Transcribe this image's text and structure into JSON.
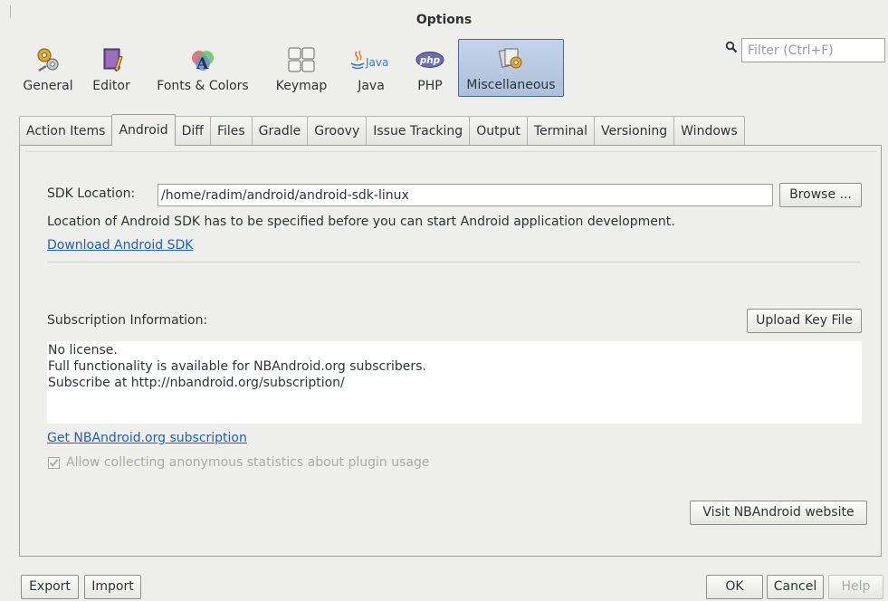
{
  "window": {
    "title": "Options"
  },
  "categories": [
    {
      "label": "General",
      "icon": "gears-icon"
    },
    {
      "label": "Editor",
      "icon": "editor-icon"
    },
    {
      "label": "Fonts & Colors",
      "icon": "fonts-colors-icon"
    },
    {
      "label": "Keymap",
      "icon": "keymap-icon"
    },
    {
      "label": "Java",
      "icon": "java-icon",
      "icon_text": "Java"
    },
    {
      "label": "PHP",
      "icon": "php-icon",
      "icon_text": "php"
    },
    {
      "label": "Miscellaneous",
      "icon": "miscellaneous-icon",
      "selected": true
    }
  ],
  "filter": {
    "placeholder": "Filter (Ctrl+F)"
  },
  "tabs": [
    {
      "label": "Action Items"
    },
    {
      "label": "Android",
      "active": true
    },
    {
      "label": "Diff"
    },
    {
      "label": "Files"
    },
    {
      "label": "Gradle"
    },
    {
      "label": "Groovy"
    },
    {
      "label": "Issue Tracking"
    },
    {
      "label": "Output"
    },
    {
      "label": "Terminal"
    },
    {
      "label": "Versioning"
    },
    {
      "label": "Windows"
    }
  ],
  "android": {
    "sdk_label": "SDK Location:",
    "sdk_value": "/home/radim/android/android-sdk-linux",
    "browse_label": "Browse ...",
    "sdk_hint": "Location of Android SDK has to be specified before you can start Android application development.",
    "download_link": "Download Android SDK",
    "subscription_label": "Subscription Information:",
    "upload_label": "Upload Key File",
    "license_lines": [
      "No license.",
      "Full functionality is available for NBAndroid.org subscribers.",
      "Subscribe at http://nbandroid.org/subscription/"
    ],
    "get_subscription_link": "Get NBAndroid.org subscription",
    "stats_checkbox_label": "Allow collecting anonymous statistics about plugin usage",
    "stats_checked": true,
    "visit_label": "Visit NBAndroid website"
  },
  "footer": {
    "export_label": "Export",
    "import_label": "Import",
    "ok_label": "OK",
    "cancel_label": "Cancel",
    "help_label": "Help"
  },
  "colors": {
    "link": "#1d5fc2",
    "selected_category": "#b5c6de",
    "background": "#eeeeec"
  }
}
